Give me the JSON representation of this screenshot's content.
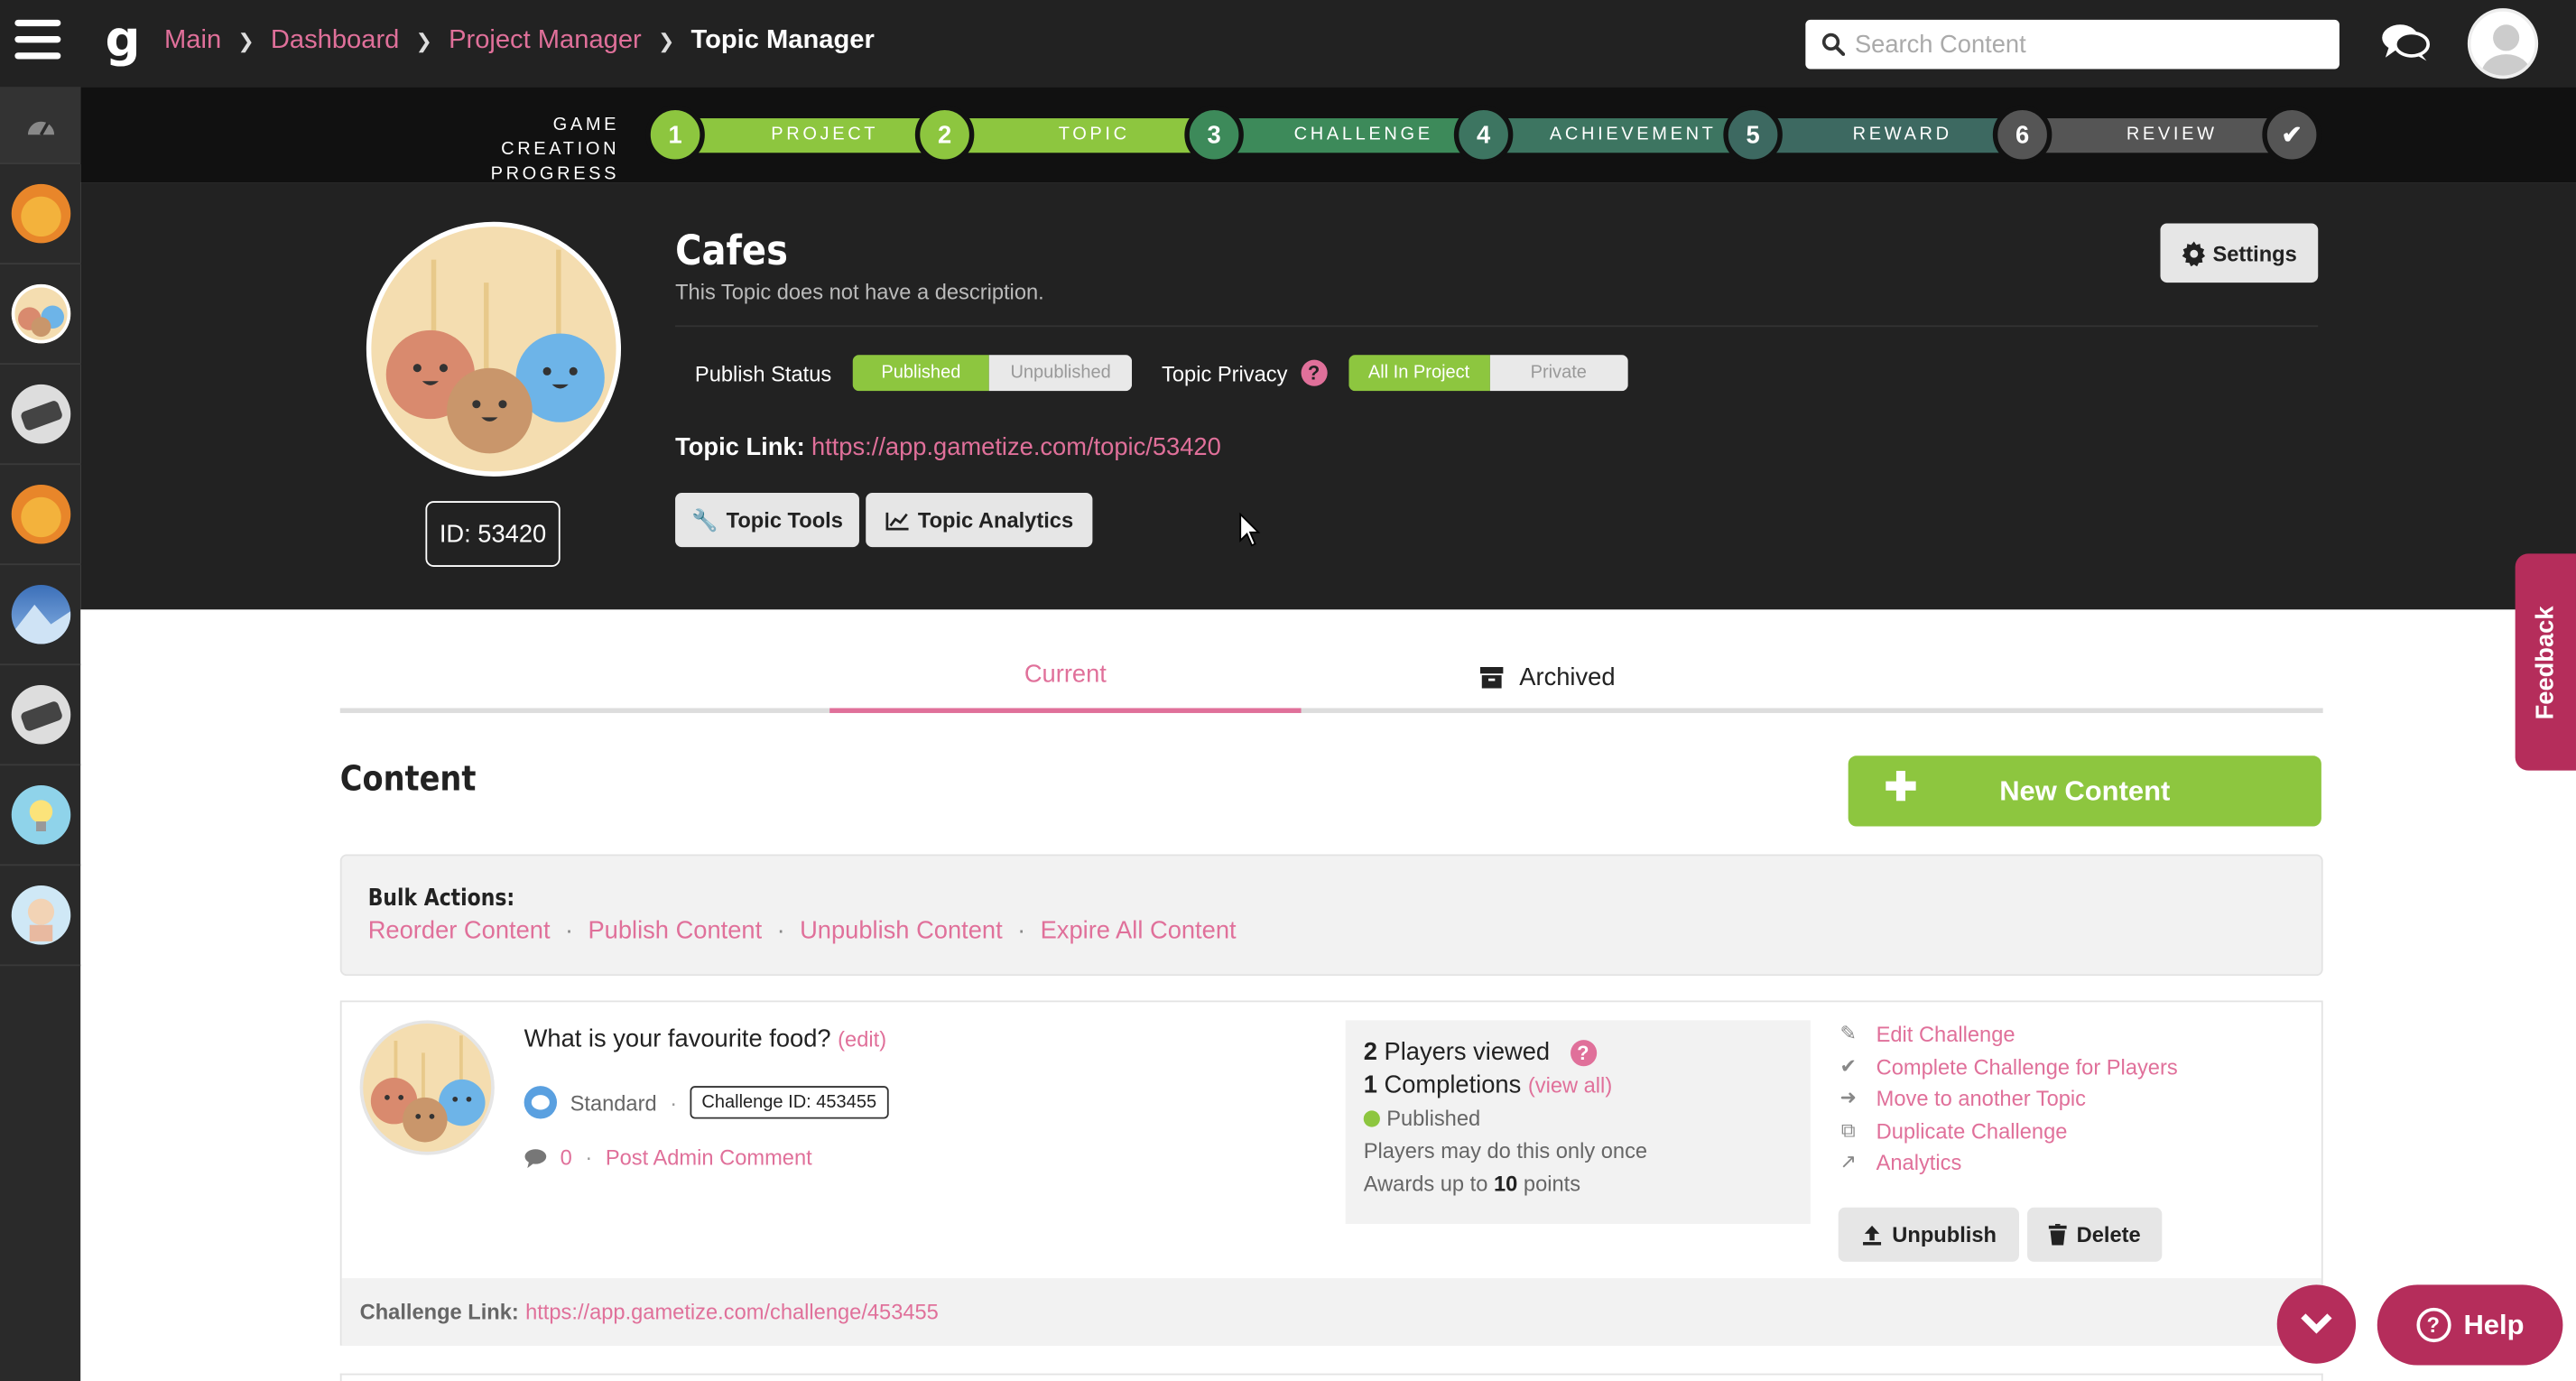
{
  "breadcrumb": [
    {
      "label": "Main"
    },
    {
      "label": "Dashboard"
    },
    {
      "label": "Project Manager"
    },
    {
      "label": "Topic Manager"
    }
  ],
  "logo": "g",
  "search": {
    "placeholder": "Search Content"
  },
  "progress": {
    "label_line1": "GAME CREATION",
    "label_line2": "PROGRESS",
    "steps": [
      {
        "num": "1",
        "label": "PROJECT",
        "color": "#8dc63f"
      },
      {
        "num": "2",
        "label": "TOPIC",
        "color": "#8dc63f"
      },
      {
        "num": "3",
        "label": "CHALLENGE",
        "color": "#3d8a5a"
      },
      {
        "num": "4",
        "label": "ACHIEVEMENT",
        "color": "#3d7561"
      },
      {
        "num": "5",
        "label": "REWARD",
        "color": "#3d6961"
      },
      {
        "num": "6",
        "label": "REVIEW",
        "color": "#555555"
      }
    ],
    "complete_icon": "check-icon"
  },
  "topic": {
    "title": "Cafes",
    "description": "This Topic does not have a description.",
    "id_label": "ID: 53420",
    "settings_label": "Settings",
    "publish_status_label": "Publish Status",
    "publish_on": "Published",
    "publish_off": "Unpublished",
    "privacy_label": "Topic Privacy",
    "privacy_on": "All In Project",
    "privacy_off": "Private",
    "link_label": "Topic Link:",
    "link_url": "https://app.gametize.com/topic/53420",
    "tools_label": "Topic Tools",
    "analytics_label": "Topic Analytics"
  },
  "tabs": {
    "current": "Current",
    "archived": "Archived"
  },
  "content": {
    "heading": "Content",
    "new_button": "New Content",
    "bulk_heading": "Bulk Actions:",
    "bulk_actions": [
      "Reorder Content",
      "Publish Content",
      "Unpublish Content",
      "Expire All Content"
    ]
  },
  "challenge": {
    "title": "What is your favourite food?",
    "edit": "(edit)",
    "type": "Standard",
    "id_label": "Challenge ID: 453455",
    "comment_count": "0",
    "post_comment": "Post Admin Comment",
    "players_viewed_num": "2",
    "players_viewed_text": "Players viewed",
    "completions_num": "1",
    "completions_text": "Completions",
    "view_all": "(view all)",
    "status": "Published",
    "repeat_text": "Players may do this only once",
    "awards_prefix": "Awards up to",
    "awards_points": "10",
    "awards_suffix": "points",
    "actions": [
      "Edit Challenge",
      "Complete Challenge for Players",
      "Move to another Topic",
      "Duplicate Challenge",
      "Analytics"
    ],
    "unpublish_label": "Unpublish",
    "delete_label": "Delete",
    "link_label": "Challenge Link:",
    "link_url": "https://app.gametize.com/challenge/453455"
  },
  "feedback_label": "Feedback",
  "help_label": "Help",
  "colors": {
    "accent": "#e0709a",
    "green": "#8dc63f",
    "brand_dark": "#b52d5b"
  }
}
